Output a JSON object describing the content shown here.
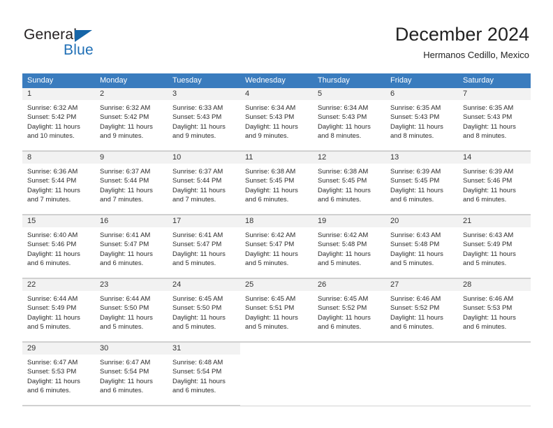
{
  "brand": {
    "name_part1": "General",
    "name_part2": "Blue"
  },
  "header": {
    "title": "December 2024",
    "subtitle": "Hermanos Cedillo, Mexico"
  },
  "colors": {
    "header_band": "#3a7cbe",
    "day_band": "#f2f2f2",
    "brand_blue": "#1f6fb6",
    "grid_line": "#d2d2d2"
  },
  "weekday_headers": [
    "Sunday",
    "Monday",
    "Tuesday",
    "Wednesday",
    "Thursday",
    "Friday",
    "Saturday"
  ],
  "weeks": [
    [
      {
        "day": "1",
        "sunrise": "Sunrise: 6:32 AM",
        "sunset": "Sunset: 5:42 PM",
        "daylight": "Daylight: 11 hours and 10 minutes."
      },
      {
        "day": "2",
        "sunrise": "Sunrise: 6:32 AM",
        "sunset": "Sunset: 5:42 PM",
        "daylight": "Daylight: 11 hours and 9 minutes."
      },
      {
        "day": "3",
        "sunrise": "Sunrise: 6:33 AM",
        "sunset": "Sunset: 5:43 PM",
        "daylight": "Daylight: 11 hours and 9 minutes."
      },
      {
        "day": "4",
        "sunrise": "Sunrise: 6:34 AM",
        "sunset": "Sunset: 5:43 PM",
        "daylight": "Daylight: 11 hours and 9 minutes."
      },
      {
        "day": "5",
        "sunrise": "Sunrise: 6:34 AM",
        "sunset": "Sunset: 5:43 PM",
        "daylight": "Daylight: 11 hours and 8 minutes."
      },
      {
        "day": "6",
        "sunrise": "Sunrise: 6:35 AM",
        "sunset": "Sunset: 5:43 PM",
        "daylight": "Daylight: 11 hours and 8 minutes."
      },
      {
        "day": "7",
        "sunrise": "Sunrise: 6:35 AM",
        "sunset": "Sunset: 5:43 PM",
        "daylight": "Daylight: 11 hours and 8 minutes."
      }
    ],
    [
      {
        "day": "8",
        "sunrise": "Sunrise: 6:36 AM",
        "sunset": "Sunset: 5:44 PM",
        "daylight": "Daylight: 11 hours and 7 minutes."
      },
      {
        "day": "9",
        "sunrise": "Sunrise: 6:37 AM",
        "sunset": "Sunset: 5:44 PM",
        "daylight": "Daylight: 11 hours and 7 minutes."
      },
      {
        "day": "10",
        "sunrise": "Sunrise: 6:37 AM",
        "sunset": "Sunset: 5:44 PM",
        "daylight": "Daylight: 11 hours and 7 minutes."
      },
      {
        "day": "11",
        "sunrise": "Sunrise: 6:38 AM",
        "sunset": "Sunset: 5:45 PM",
        "daylight": "Daylight: 11 hours and 6 minutes."
      },
      {
        "day": "12",
        "sunrise": "Sunrise: 6:38 AM",
        "sunset": "Sunset: 5:45 PM",
        "daylight": "Daylight: 11 hours and 6 minutes."
      },
      {
        "day": "13",
        "sunrise": "Sunrise: 6:39 AM",
        "sunset": "Sunset: 5:45 PM",
        "daylight": "Daylight: 11 hours and 6 minutes."
      },
      {
        "day": "14",
        "sunrise": "Sunrise: 6:39 AM",
        "sunset": "Sunset: 5:46 PM",
        "daylight": "Daylight: 11 hours and 6 minutes."
      }
    ],
    [
      {
        "day": "15",
        "sunrise": "Sunrise: 6:40 AM",
        "sunset": "Sunset: 5:46 PM",
        "daylight": "Daylight: 11 hours and 6 minutes."
      },
      {
        "day": "16",
        "sunrise": "Sunrise: 6:41 AM",
        "sunset": "Sunset: 5:47 PM",
        "daylight": "Daylight: 11 hours and 6 minutes."
      },
      {
        "day": "17",
        "sunrise": "Sunrise: 6:41 AM",
        "sunset": "Sunset: 5:47 PM",
        "daylight": "Daylight: 11 hours and 5 minutes."
      },
      {
        "day": "18",
        "sunrise": "Sunrise: 6:42 AM",
        "sunset": "Sunset: 5:47 PM",
        "daylight": "Daylight: 11 hours and 5 minutes."
      },
      {
        "day": "19",
        "sunrise": "Sunrise: 6:42 AM",
        "sunset": "Sunset: 5:48 PM",
        "daylight": "Daylight: 11 hours and 5 minutes."
      },
      {
        "day": "20",
        "sunrise": "Sunrise: 6:43 AM",
        "sunset": "Sunset: 5:48 PM",
        "daylight": "Daylight: 11 hours and 5 minutes."
      },
      {
        "day": "21",
        "sunrise": "Sunrise: 6:43 AM",
        "sunset": "Sunset: 5:49 PM",
        "daylight": "Daylight: 11 hours and 5 minutes."
      }
    ],
    [
      {
        "day": "22",
        "sunrise": "Sunrise: 6:44 AM",
        "sunset": "Sunset: 5:49 PM",
        "daylight": "Daylight: 11 hours and 5 minutes."
      },
      {
        "day": "23",
        "sunrise": "Sunrise: 6:44 AM",
        "sunset": "Sunset: 5:50 PM",
        "daylight": "Daylight: 11 hours and 5 minutes."
      },
      {
        "day": "24",
        "sunrise": "Sunrise: 6:45 AM",
        "sunset": "Sunset: 5:50 PM",
        "daylight": "Daylight: 11 hours and 5 minutes."
      },
      {
        "day": "25",
        "sunrise": "Sunrise: 6:45 AM",
        "sunset": "Sunset: 5:51 PM",
        "daylight": "Daylight: 11 hours and 5 minutes."
      },
      {
        "day": "26",
        "sunrise": "Sunrise: 6:45 AM",
        "sunset": "Sunset: 5:52 PM",
        "daylight": "Daylight: 11 hours and 6 minutes."
      },
      {
        "day": "27",
        "sunrise": "Sunrise: 6:46 AM",
        "sunset": "Sunset: 5:52 PM",
        "daylight": "Daylight: 11 hours and 6 minutes."
      },
      {
        "day": "28",
        "sunrise": "Sunrise: 6:46 AM",
        "sunset": "Sunset: 5:53 PM",
        "daylight": "Daylight: 11 hours and 6 minutes."
      }
    ],
    [
      {
        "day": "29",
        "sunrise": "Sunrise: 6:47 AM",
        "sunset": "Sunset: 5:53 PM",
        "daylight": "Daylight: 11 hours and 6 minutes."
      },
      {
        "day": "30",
        "sunrise": "Sunrise: 6:47 AM",
        "sunset": "Sunset: 5:54 PM",
        "daylight": "Daylight: 11 hours and 6 minutes."
      },
      {
        "day": "31",
        "sunrise": "Sunrise: 6:48 AM",
        "sunset": "Sunset: 5:54 PM",
        "daylight": "Daylight: 11 hours and 6 minutes."
      },
      {
        "day": "",
        "sunrise": "",
        "sunset": "",
        "daylight": ""
      },
      {
        "day": "",
        "sunrise": "",
        "sunset": "",
        "daylight": ""
      },
      {
        "day": "",
        "sunrise": "",
        "sunset": "",
        "daylight": ""
      },
      {
        "day": "",
        "sunrise": "",
        "sunset": "",
        "daylight": ""
      }
    ]
  ]
}
